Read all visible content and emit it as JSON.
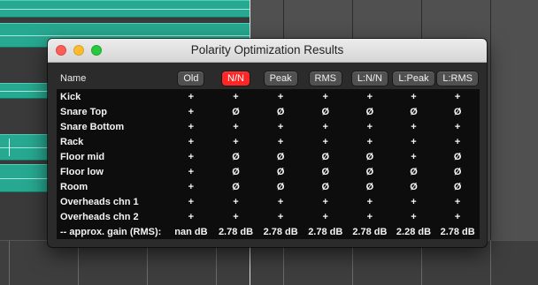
{
  "window": {
    "title": "Polarity Optimization Results"
  },
  "table": {
    "name_header": "Name",
    "columns": [
      "Old",
      "N/N",
      "Peak",
      "RMS",
      "L:N/N",
      "L:Peak",
      "L:RMS"
    ],
    "active_column": "N/N",
    "active_color": "#ff2626",
    "rows": [
      {
        "name": "Kick",
        "values": [
          "+",
          "+",
          "+",
          "+",
          "+",
          "+",
          "+"
        ]
      },
      {
        "name": "Snare Top",
        "values": [
          "+",
          "Ø",
          "Ø",
          "Ø",
          "Ø",
          "Ø",
          "Ø"
        ]
      },
      {
        "name": "Snare Bottom",
        "values": [
          "+",
          "+",
          "+",
          "+",
          "+",
          "+",
          "+"
        ]
      },
      {
        "name": "Rack",
        "values": [
          "+",
          "+",
          "+",
          "+",
          "+",
          "+",
          "+"
        ]
      },
      {
        "name": "Floor mid",
        "values": [
          "+",
          "Ø",
          "Ø",
          "Ø",
          "Ø",
          "+",
          "Ø"
        ]
      },
      {
        "name": "Floor low",
        "values": [
          "+",
          "Ø",
          "Ø",
          "Ø",
          "Ø",
          "Ø",
          "Ø"
        ]
      },
      {
        "name": "Room",
        "values": [
          "+",
          "Ø",
          "Ø",
          "Ø",
          "Ø",
          "Ø",
          "Ø"
        ]
      },
      {
        "name": "Overheads chn 1",
        "values": [
          "+",
          "+",
          "+",
          "+",
          "+",
          "+",
          "+"
        ]
      },
      {
        "name": "Overheads chn 2",
        "values": [
          "+",
          "+",
          "+",
          "+",
          "+",
          "+",
          "+"
        ]
      }
    ],
    "gain_row": {
      "label": "-- approx. gain (RMS):",
      "values": [
        "nan dB",
        "2.78 dB",
        "2.78 dB",
        "2.78 dB",
        "2.78 dB",
        "2.28 dB",
        "2.78 dB"
      ]
    }
  },
  "colors": {
    "track": "#27a890",
    "close": "#fc5f57",
    "minimize": "#fdbc2e",
    "zoom": "#28c840"
  }
}
